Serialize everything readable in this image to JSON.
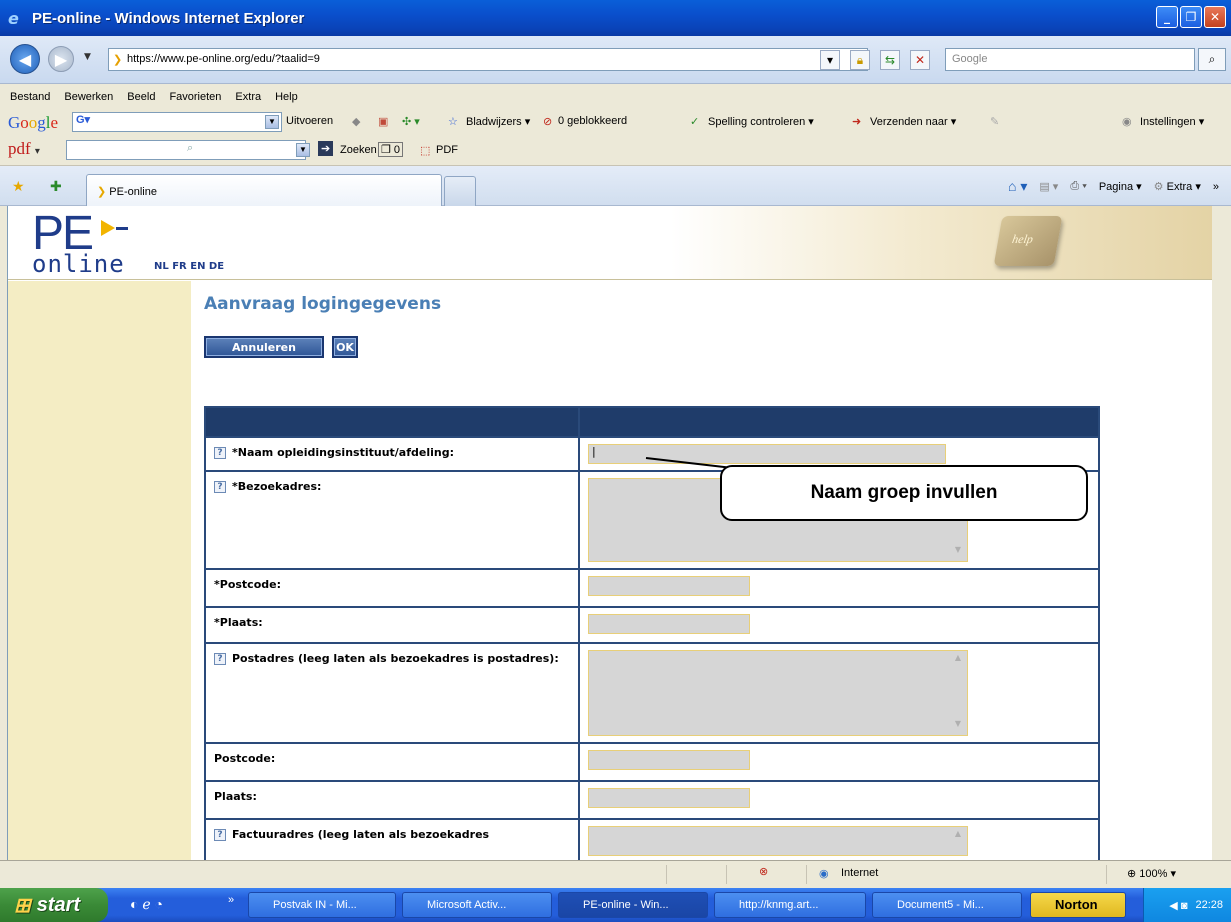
{
  "window": {
    "title": "PE-online - Windows Internet Explorer"
  },
  "address": {
    "url": "https://www.pe-online.org/edu/?taalid=9",
    "search_placeholder": "Google"
  },
  "menu": [
    "Bestand",
    "Bewerken",
    "Beeld",
    "Favorieten",
    "Extra",
    "Help"
  ],
  "google_toolbar": {
    "run": "Uitvoeren",
    "bookmarks": "Bladwijzers",
    "blocked": "0 geblokkeerd",
    "spelling": "Spelling controleren",
    "send": "Verzenden naar",
    "settings": "Instellingen"
  },
  "pdf_toolbar": {
    "logo": "pdf",
    "search": "Zoeken",
    "count": "0",
    "pdf": "PDF"
  },
  "tabs": {
    "active": "PE-online",
    "page": "Pagina",
    "extra": "Extra"
  },
  "site": {
    "logo_pe": "PE",
    "logo_online": "online",
    "languages": "NL FR EN DE",
    "help_key": "help"
  },
  "page": {
    "title": "Aanvraag logingegevens",
    "cancel_label": "Annuleren",
    "ok_label": "OK"
  },
  "form": {
    "rows": [
      {
        "label": "*Naam opleidingsinstituut/afdeling:",
        "help": true,
        "type": "input",
        "value": ""
      },
      {
        "label": "*Bezoekadres:",
        "help": true,
        "type": "textarea",
        "value": ""
      },
      {
        "label": "*Postcode:",
        "help": false,
        "type": "short",
        "value": ""
      },
      {
        "label": "*Plaats:",
        "help": false,
        "type": "short",
        "value": ""
      },
      {
        "label": "Postadres (leeg laten als bezoekadres is postadres):",
        "help": true,
        "type": "textarea",
        "value": ""
      },
      {
        "label": "Postcode:",
        "help": false,
        "type": "short",
        "value": ""
      },
      {
        "label": "Plaats:",
        "help": false,
        "type": "short",
        "value": ""
      },
      {
        "label": "Factuuradres (leeg laten als bezoekadres",
        "help": true,
        "type": "textarea",
        "value": ""
      }
    ]
  },
  "callout": "Naam groep invullen",
  "status": {
    "zone": "Internet",
    "zoom": "100%"
  },
  "taskbar": {
    "start": "start",
    "tasks": [
      "Postvak IN - Mi...",
      "Microsoft Activ...",
      "PE-online - Win...",
      "http://knmg.art...",
      "Document5 - Mi...",
      "Norton"
    ],
    "clock": "22:28"
  }
}
